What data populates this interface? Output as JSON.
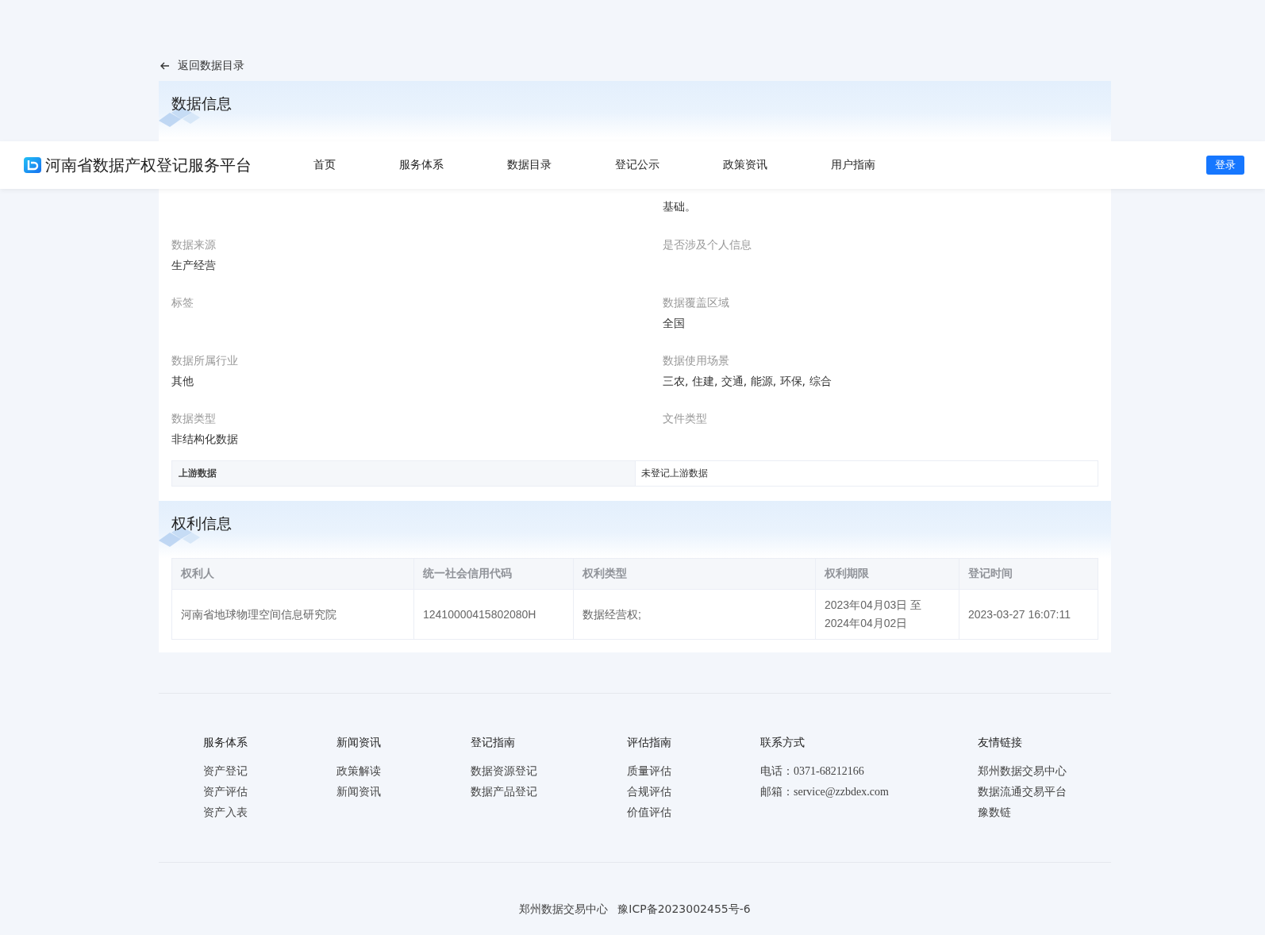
{
  "header": {
    "site_title": "河南省数据产权登记服务平台",
    "nav": [
      {
        "label": "首页",
        "selected": false
      },
      {
        "label": "服务体系",
        "selected": false
      },
      {
        "label": "数据目录",
        "selected": false
      },
      {
        "label": "登记公示",
        "selected": false
      },
      {
        "label": "政策资讯",
        "selected": false
      },
      {
        "label": "用户指南",
        "selected": false
      }
    ],
    "login_button": "登录"
  },
  "back_link": "返回数据目录",
  "data_info": {
    "title": "数据信息",
    "description_tail": "基础。",
    "fields": [
      {
        "label": "数据来源",
        "value": "生产经营"
      },
      {
        "label": "是否涉及个人信息"
      },
      {
        "label": "标签"
      },
      {
        "label": "数据覆盖区域",
        "value": "全国"
      },
      {
        "label": "数据所属行业",
        "value": "其他"
      },
      {
        "label": "数据使用场景",
        "value": "三农, 住建, 交通, 能源, 环保, 综合"
      },
      {
        "label": "数据类型",
        "value": "非结构化数据"
      },
      {
        "label": "文件类型"
      }
    ],
    "upstream": {
      "label": "上游数据",
      "value": "未登记上游数据"
    }
  },
  "rights_info": {
    "title": "权利信息",
    "table": {
      "columns": [
        "权利人",
        "统一社会信用代码",
        "权利类型",
        "权利期限",
        "登记时间"
      ],
      "rows": [
        [
          "河南省地球物理空间信息研究院",
          "12410000415802080H",
          "数据经营权;",
          "2023年04月03日 至 2024年04月02日",
          "2023-03-27 16:07:11"
        ]
      ]
    }
  },
  "footer": {
    "columns": [
      {
        "heading": "服务体系",
        "items": [
          "资产登记",
          "资产评估",
          "资产入表"
        ]
      },
      {
        "heading": "新闻资讯",
        "items": [
          "政策解读",
          "新闻资讯"
        ]
      },
      {
        "heading": "登记指南",
        "items": [
          "数据资源登记",
          "数据产品登记"
        ]
      },
      {
        "heading": "评估指南",
        "items": [
          "质量评估",
          "合规评估",
          "价值评估"
        ]
      },
      {
        "heading": "联系方式",
        "items": [
          "电话：0371-68212166",
          "邮箱：service@zzbdex.com"
        ]
      },
      {
        "heading": "友情链接",
        "items": [
          "郑州数据交易中心",
          "数据流通交易平台",
          "豫数链"
        ]
      }
    ],
    "copyright": [
      "郑州数据交易中心",
      "豫ICP备2023002455号-6"
    ]
  }
}
